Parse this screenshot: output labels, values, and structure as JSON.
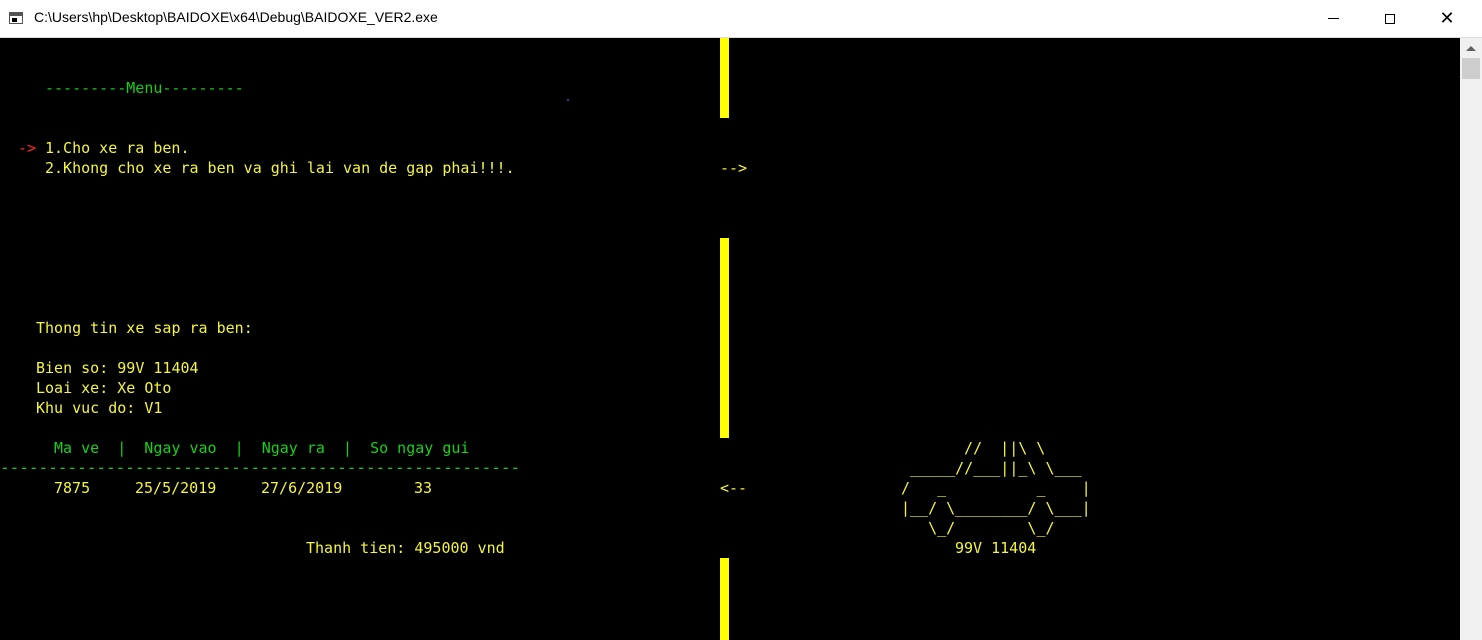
{
  "window": {
    "title": "C:\\Users\\hp\\Desktop\\BAIDOXE\\x64\\Debug\\BAIDOXE_VER2.exe",
    "close_glyph": "✕"
  },
  "menu": {
    "header": "---------Menu---------",
    "pointer": "->",
    "option1": "1.Cho xe ra ben.",
    "option2": "2.Khong cho xe ra ben va ghi lai van de gap phai!!!."
  },
  "vehicle_info": {
    "heading": "Thong tin xe sap ra ben:",
    "plate_line": "Bien so: 99V 11404",
    "type_line": "Loai xe: Xe Oto",
    "zone_line": "Khu vuc do: V1"
  },
  "ticket_table": {
    "header": "Ma ve  |  Ngay vao  |  Ngay ra  |  So ngay gui",
    "separator": "------------------------------------------------------",
    "row": {
      "ma_ve": "7875",
      "ngay_vao": "25/5/2019",
      "ngay_ra": "27/6/2019",
      "so_ngay_gui": "33"
    }
  },
  "total": "Thanh tien: 495000 vnd",
  "gate": {
    "in_arrow": "-->",
    "out_arrow": "<--"
  },
  "car_art": {
    "lines": [
      "  //  ||\\ \\",
      "_____//___||_\\ \\___",
      "/   _          _    |",
      "|__/ \\________/ \\___|",
      "   \\_/        \\_/"
    ],
    "plate": "99V 11404"
  },
  "colors": {
    "text_yellow": "#f5f53c",
    "text_green": "#17d117",
    "pointer_red": "#ff2a2a",
    "gate_bar": "#ffff00",
    "background": "#000000"
  }
}
